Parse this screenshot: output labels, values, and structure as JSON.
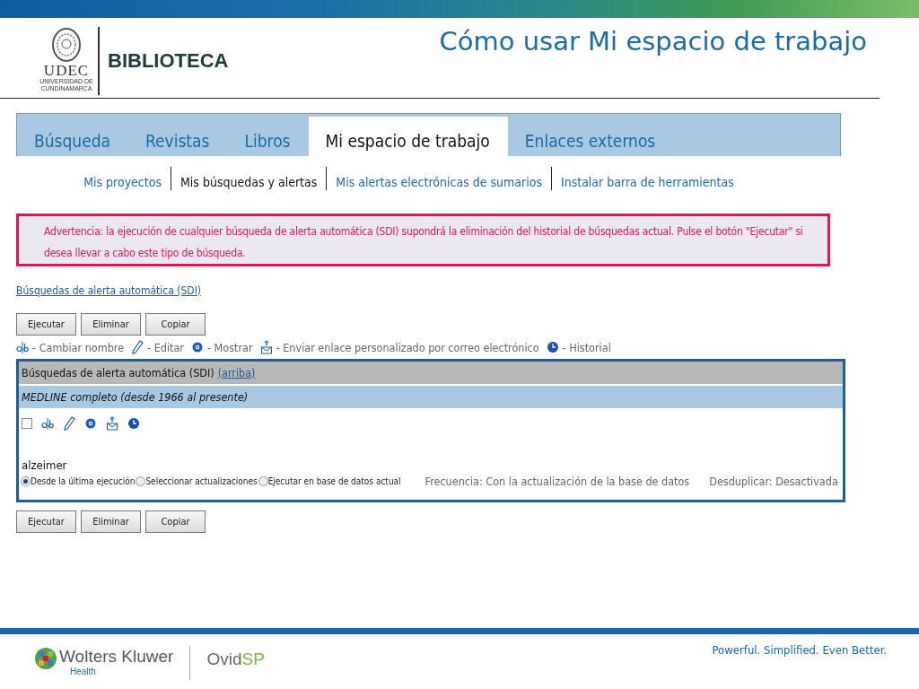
{
  "header": {
    "logo": {
      "name": "UDEC",
      "subtitle": "UNIVERSIDAD DE CUNDINAMARCA"
    },
    "section": "BIBLIOTECA",
    "title": "Cómo usar Mi espacio de trabajo"
  },
  "tabs": [
    {
      "label": "Búsqueda",
      "selected": false
    },
    {
      "label": "Revistas",
      "selected": false
    },
    {
      "label": "Libros",
      "selected": false
    },
    {
      "label": "Mi espacio de trabajo",
      "selected": true
    },
    {
      "label": "Enlaces externos",
      "selected": false
    }
  ],
  "subnav": [
    {
      "label": "Mis proyectos",
      "selected": false
    },
    {
      "label": "Mis búsquedas y alertas",
      "selected": true
    },
    {
      "label": "Mis alertas electrónicas de sumarios",
      "selected": false
    },
    {
      "label": "Instalar barra de herramientas",
      "selected": false
    }
  ],
  "warning": "Advertencia: la ejecución de cualquier búsqueda de alerta automática (SDI) supondrá la eliminación del historial de búsquedas actual. Pulse el botón \"Ejecutar\" si desea llevar a cabo este tipo de búsqueda.",
  "section_link": "Búsquedas de alerta automática (SDI)",
  "buttons_top": [
    "Ejecutar",
    "Eliminar",
    "Copiar"
  ],
  "legend": [
    {
      "kind": "rename",
      "label": "- Cambiar nombre"
    },
    {
      "kind": "edit",
      "label": "- Editar"
    },
    {
      "kind": "show",
      "label": "- Mostrar"
    },
    {
      "kind": "email",
      "label": "- Enviar enlace personalizado por correo electrónico"
    },
    {
      "kind": "history",
      "label": "- Historial"
    }
  ],
  "table": {
    "title": "Búsquedas de alerta automática (SDI)",
    "title_link": "(arriba)",
    "database": "MEDLINE completo (desde 1966 al presente)",
    "row": {
      "checked": false,
      "query": "alzeimer",
      "options": [
        {
          "label": "Desde la última ejecución",
          "selected": true
        },
        {
          "label": "Seleccionar actualizaciones",
          "selected": false
        },
        {
          "label": "Ejecutar en base de datos actual",
          "selected": false
        }
      ],
      "frequency": "Frecuencia: Con la actualización de la base de datos",
      "dedupe": "Desduplicar: Desactivada"
    }
  },
  "buttons_bottom": [
    "Ejecutar",
    "Eliminar",
    "Copiar"
  ],
  "footer": {
    "brand": "Wolters Kluwer",
    "division": "Health",
    "product": "Ovid",
    "product_suffix": "SP",
    "tagline": "Powerful. Simplified. Even Better."
  }
}
